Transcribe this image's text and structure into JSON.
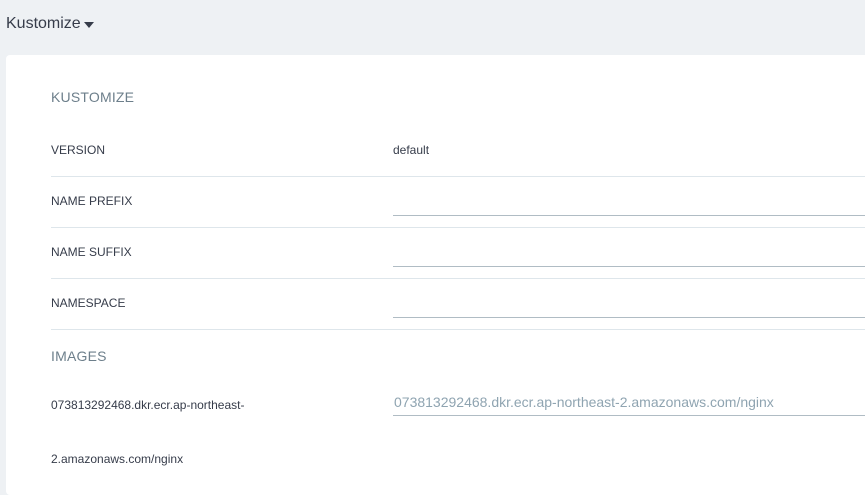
{
  "header": {
    "title": "Kustomize"
  },
  "kustomize": {
    "section_title": "KUSTOMIZE",
    "rows": [
      {
        "label": "VERSION",
        "value": "default"
      },
      {
        "label": "NAME PREFIX",
        "value": ""
      },
      {
        "label": "NAME SUFFIX",
        "value": ""
      },
      {
        "label": "NAMESPACE",
        "value": ""
      }
    ]
  },
  "images": {
    "section_title": "IMAGES",
    "items": [
      {
        "label_line1": "073813292468.dkr.ecr.ap-northeast-",
        "label_line2": "2.amazonaws.com/nginx",
        "placeholder": "073813292468.dkr.ecr.ap-northeast-2.amazonaws.com/nginx"
      }
    ]
  }
}
